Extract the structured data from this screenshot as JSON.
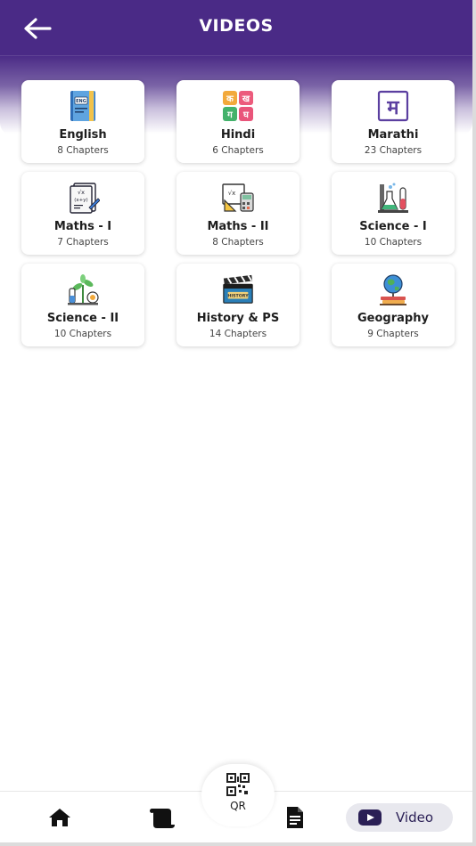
{
  "header": {
    "title": "VIDEOS",
    "back_icon": "arrow-left-icon",
    "bg_color": "#4a2a86"
  },
  "subjects": [
    {
      "name": "English",
      "chapters": "8 Chapters",
      "icon": "english-book-icon"
    },
    {
      "name": "Hindi",
      "chapters": "6 Chapters",
      "icon": "hindi-letters-icon"
    },
    {
      "name": "Marathi",
      "chapters": "23 Chapters",
      "icon": "marathi-letter-icon"
    },
    {
      "name": "Maths - I",
      "chapters": "7 Chapters",
      "icon": "maths-notebook-icon"
    },
    {
      "name": "Maths - II",
      "chapters": "8 Chapters",
      "icon": "geometry-tools-icon"
    },
    {
      "name": "Science - I",
      "chapters": "10 Chapters",
      "icon": "lab-flask-icon"
    },
    {
      "name": "Science - II",
      "chapters": "10 Chapters",
      "icon": "plant-science-icon"
    },
    {
      "name": "History & PS",
      "chapters": "14 Chapters",
      "icon": "history-clapperboard-icon"
    },
    {
      "name": "Geography",
      "chapters": "9 Chapters",
      "icon": "globe-books-icon"
    }
  ],
  "bottom_nav": {
    "home_icon": "home-icon",
    "scroll_icon": "scroll-icon",
    "qr_label": "QR",
    "qr_icon": "qr-code-icon",
    "doc_icon": "document-icon",
    "video_label": "Video",
    "video_icon": "youtube-play-icon",
    "active_color": "#2a1f55"
  }
}
